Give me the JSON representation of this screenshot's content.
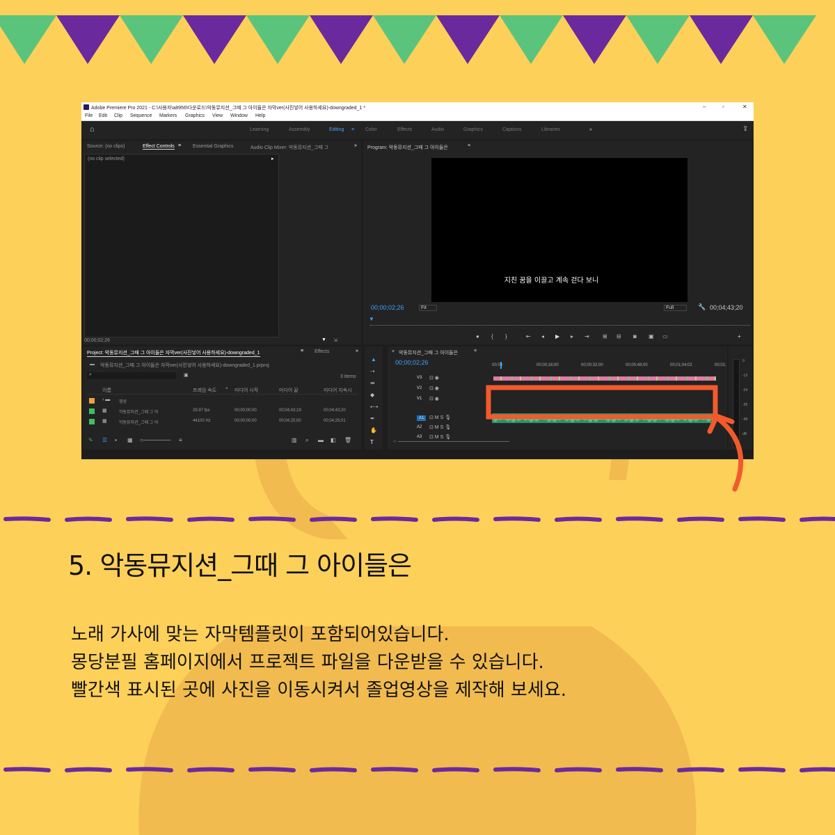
{
  "colors": {
    "background": "#fdd05a",
    "flag_green": "#5ac47c",
    "flag_purple": "#6a2a9e",
    "dash_purple": "#6a2a9e",
    "highlight_red": "#f25a2b",
    "decor_yellow": "#f1bb4f"
  },
  "window": {
    "title": "Adobe Premiere Pro 2021 - C:\\사용자\\a8956\\다운로드\\악동뮤지션_그때 그 아이들은 자막ver(사진넣어 사용하세요)-downgraded_1 *",
    "controls": [
      "–",
      "▫",
      "✕"
    ],
    "menu": [
      "File",
      "Edit",
      "Clip",
      "Sequence",
      "Markers",
      "Graphics",
      "View",
      "Window",
      "Help"
    ],
    "workspaces": [
      "Learning",
      "Assembly",
      "Editing",
      "Color",
      "Effects",
      "Audio",
      "Graphics",
      "Captions",
      "Libraries"
    ],
    "active_workspace": "Editing"
  },
  "source_panel": {
    "tabs": [
      "Source: (no clips)",
      "Effect Controls",
      "Essential Graphics",
      "Audio Clip Mixer: 악동뮤지션_그때 그"
    ],
    "no_clip": "(no clip selected)",
    "timecode": "00;00;02;26"
  },
  "program": {
    "title": "Program: 악동뮤지션_그때 그 아이들은",
    "subtitle": "지친 꿈을 이끌고 계속 걷다 보니",
    "timecode": "00;00;02;26",
    "fit": "Fit",
    "full": "Full",
    "duration": "00;04;43;20"
  },
  "project": {
    "tabs": [
      "Project: 악동뮤지션_그때 그 아이들은 자막ver(사진넣어 사용하세요)-downgraded_1",
      "Effects"
    ],
    "path": "악동뮤지션_그때 그 아이들은 자막ver(사진넣어 사용하세요)-downgraded_1.prproj",
    "count": "3 items",
    "columns": [
      "이름",
      "프레임 속도",
      "미디어 시작",
      "미디어 끝",
      "미디어 지속시"
    ],
    "rows": [
      {
        "name": "영상",
        "fps": "",
        "start": "",
        "end": "",
        "dur": "",
        "color": "#e8a33a"
      },
      {
        "name": "악동뮤지션_그때 그 아",
        "fps": "29.97 fps",
        "start": "00;00;00;00",
        "end": "00;04;43;19",
        "dur": "00;04;43;20",
        "color": "#3fbf5f"
      },
      {
        "name": "악동뮤지션_그때 그 아",
        "fps": "44100 Hz",
        "start": "00;00;00;00",
        "end": "00;04;25;00",
        "dur": "00;04;25;01",
        "color": "#3fbf5f"
      }
    ]
  },
  "timeline": {
    "title": "악동뮤지션_그때 그 아이들은",
    "timecode": "00;00;02;26",
    "ruler": [
      "00;00",
      "00;00;16;00",
      "00;00;32;00",
      "00;00;48;00",
      "00;01;04;02",
      "00;01;"
    ],
    "tracks": [
      "V3",
      "V2",
      "V1",
      "A1",
      "A2",
      "A3"
    ],
    "meter": [
      "0",
      "-12",
      "-24",
      "-36",
      "-48",
      "dB"
    ]
  },
  "heading": "5. 악동뮤지션_그때 그 아이들은",
  "body": [
    "노래 가사에 맞는 자막템플릿이 포함되어있습니다.",
    "몽당분필 홈페이지에서 프로젝트 파일을 다운받을 수 있습니다.",
    "빨간색 표시된 곳에 사진을 이동시켜서 졸업영상을 제작해 보세요."
  ]
}
